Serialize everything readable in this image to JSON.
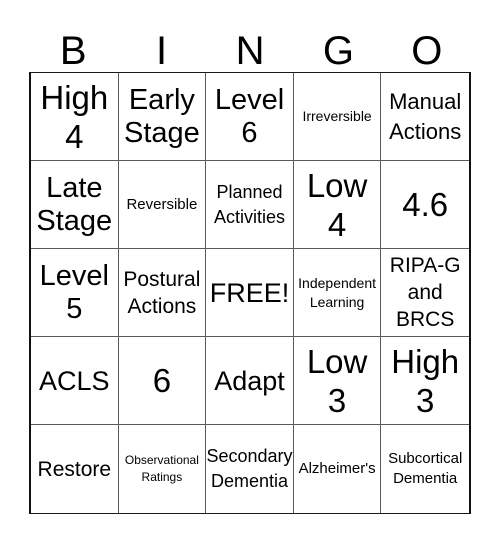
{
  "header": {
    "letters": [
      "B",
      "I",
      "N",
      "G",
      "O"
    ]
  },
  "card": {
    "cells": [
      {
        "text": "High\n4",
        "size": "s-xl"
      },
      {
        "text": "Early\nStage",
        "size": "s-l"
      },
      {
        "text": "Level\n6",
        "size": "s-l"
      },
      {
        "text": "Irreversible",
        "size": "s-xs"
      },
      {
        "text": "Manual\nActions",
        "size": "s-m"
      },
      {
        "text": "Late\nStage",
        "size": "s-l"
      },
      {
        "text": "Reversible",
        "size": "s-s"
      },
      {
        "text": "Planned\nActivities",
        "size": "s-sm"
      },
      {
        "text": "Low\n4",
        "size": "s-xl"
      },
      {
        "text": "4.6",
        "size": "s-xl"
      },
      {
        "text": "Level\n5",
        "size": "s-l"
      },
      {
        "text": "Postural\nActions",
        "size": "s-ms"
      },
      {
        "text": "FREE!",
        "size": "s-lm"
      },
      {
        "text": "Independent\nLearning",
        "size": "s-xs"
      },
      {
        "text": "RIPA-G\nand\nBRCS",
        "size": "s-ms"
      },
      {
        "text": "ACLS",
        "size": "s-lm"
      },
      {
        "text": "6",
        "size": "s-xl"
      },
      {
        "text": "Adapt",
        "size": "s-lm"
      },
      {
        "text": "Low\n3",
        "size": "s-xl"
      },
      {
        "text": "High\n3",
        "size": "s-xl"
      },
      {
        "text": "Restore",
        "size": "s-ms"
      },
      {
        "text": "Observational\nRatings",
        "size": "s-xxs"
      },
      {
        "text": "Secondary\nDementia",
        "size": "s-sm"
      },
      {
        "text": "Alzheimer's",
        "size": "s-s"
      },
      {
        "text": "Subcortical\nDementia",
        "size": "s-s"
      }
    ]
  }
}
